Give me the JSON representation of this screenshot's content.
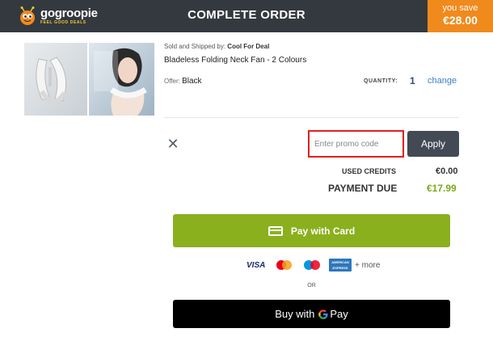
{
  "header": {
    "logo_name_go": "go",
    "logo_name_rest": "groopie",
    "logo_tagline": "FEEL GOOD DEALS",
    "title": "COMPLETE ORDER",
    "save_label": "you save",
    "save_value": "€28.00"
  },
  "product": {
    "seller_prefix": "Sold and Shipped by:",
    "seller_name": "Cool For Deal",
    "name": "Bladeless Folding Neck Fan - 2 Colours",
    "offer_label": "Offer:",
    "offer_value": "Black",
    "quantity_label": "QUANTITY:",
    "quantity_value": "1",
    "change_label": "change"
  },
  "promo": {
    "close_glyph": "✕",
    "placeholder": "Enter promo code",
    "apply_label": "Apply"
  },
  "totals": {
    "used_credits_label": "USED CREDITS",
    "used_credits_value": "€0.00",
    "payment_due_label": "PAYMENT DUE",
    "payment_due_value": "€17.99"
  },
  "payment": {
    "card_button_label": "Pay with Card",
    "card_logos": [
      "VISA",
      "mastercard",
      "maestro",
      "AMERICAN EXPRESS"
    ],
    "visa_text": "VISA",
    "amex_text": "AMERICAN EXPRESS",
    "more_label": "+ more",
    "or_label": "OR",
    "gpay_prefix": "Buy with",
    "gpay_g": "G",
    "gpay_pay": "Pay"
  },
  "colors": {
    "topbar": "#33393f",
    "save_orange": "#f08a1d",
    "pay_green": "#8ab01e",
    "due_green": "#7ba91a",
    "link_blue": "#3a7fc8",
    "promo_border_red": "#e02020"
  }
}
